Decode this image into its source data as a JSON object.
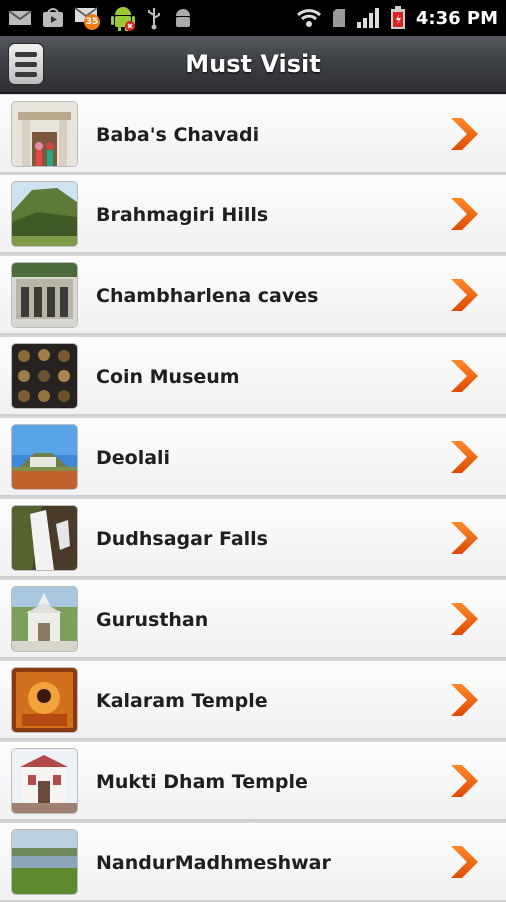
{
  "status_bar": {
    "time": "4:36 PM",
    "notification_count": "35",
    "icons": [
      "mail-icon",
      "play-store-icon",
      "mail-badge-icon",
      "android-icon",
      "usb-icon",
      "android-debug-icon",
      "wifi-icon",
      "sd-card-icon",
      "signal-icon",
      "battery-icon"
    ]
  },
  "header": {
    "title": "Must Visit",
    "menu_icon": "menu-icon"
  },
  "list": {
    "items": [
      {
        "label": "Baba's Chavadi",
        "thumb": "shrine"
      },
      {
        "label": "Brahmagiri Hills",
        "thumb": "hills"
      },
      {
        "label": "Chambharlena caves",
        "thumb": "caves"
      },
      {
        "label": "Coin Museum",
        "thumb": "coins"
      },
      {
        "label": "Deolali",
        "thumb": "deolali"
      },
      {
        "label": "Dudhsagar Falls",
        "thumb": "falls"
      },
      {
        "label": "Gurusthan",
        "thumb": "temple-white"
      },
      {
        "label": "Kalaram Temple",
        "thumb": "temple-orange"
      },
      {
        "label": "Mukti Dham Temple",
        "thumb": "mukti"
      },
      {
        "label": "NandurMadhmeshwar",
        "thumb": "lake"
      }
    ],
    "chevron_icon": "chevron-right-icon"
  },
  "colors": {
    "accent": "#f26b10",
    "header_top": "#55585c",
    "header_bottom": "#2d2f33",
    "row_text": "#1f1f1f"
  }
}
